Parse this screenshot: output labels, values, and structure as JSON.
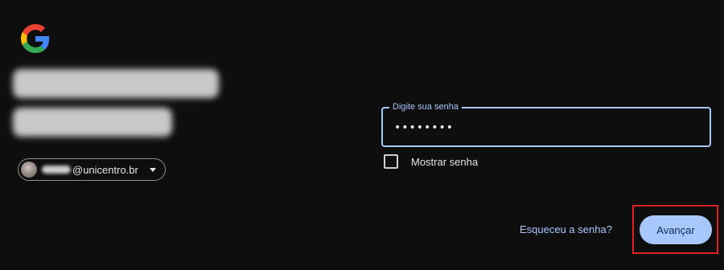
{
  "logo": {
    "icon": "google-g-icon"
  },
  "account": {
    "email_domain": "@unicentro.br",
    "dropdown_icon": "chevron-down-icon"
  },
  "password_field": {
    "label": "Digite sua senha",
    "value": "••••••••"
  },
  "show_password": {
    "label": "Mostrar senha",
    "checked": false
  },
  "actions": {
    "forgot_label": "Esqueceu a senha?",
    "next_label": "Avançar"
  },
  "colors": {
    "background": "#0e0e0e",
    "accent": "#a8c7fa",
    "highlight_box": "#e01f1f"
  }
}
